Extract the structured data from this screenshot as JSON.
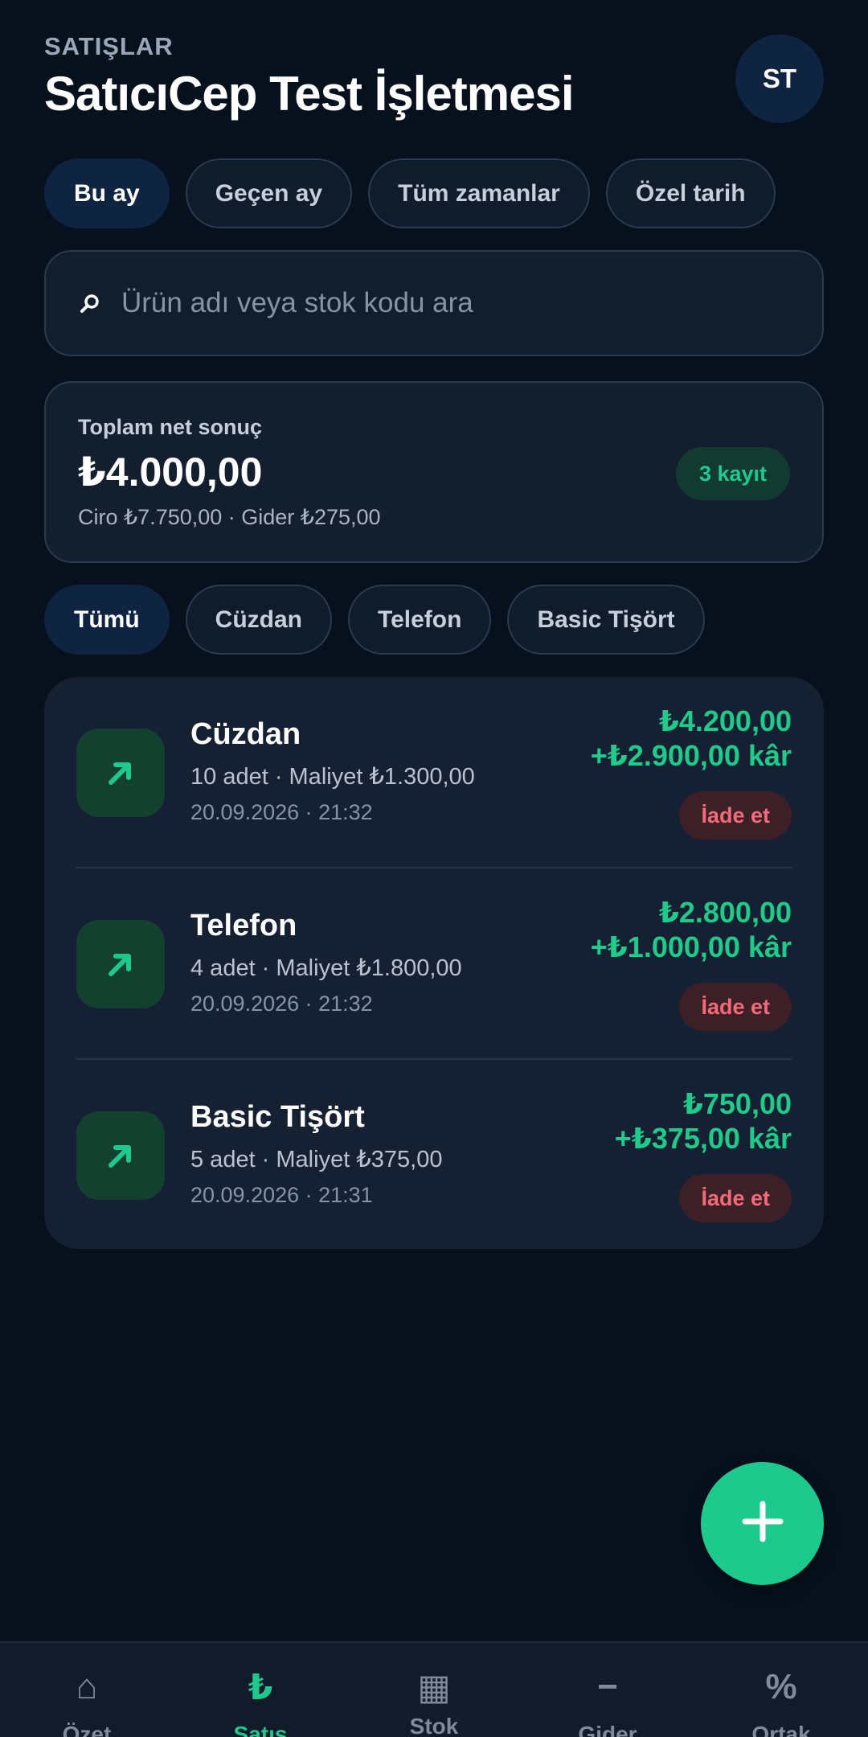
{
  "header": {
    "eyebrow": "SATIŞLAR",
    "title": "SatıcıCep Test İşletmesi",
    "avatar_initials": "ST"
  },
  "date_filters": [
    {
      "label": "Bu ay",
      "active": true
    },
    {
      "label": "Geçen ay",
      "active": false
    },
    {
      "label": "Tüm zamanlar",
      "active": false
    },
    {
      "label": "Özel tarih",
      "active": false
    }
  ],
  "search": {
    "placeholder": "Ürün adı veya stok kodu ara",
    "value": ""
  },
  "summary": {
    "label": "Toplam net sonuç",
    "value": "₺4.000,00",
    "subtitle": "Ciro ₺7.750,00 · Gider ₺275,00",
    "record_badge": "3 kayıt"
  },
  "category_filters": [
    {
      "label": "Tümü",
      "active": true
    },
    {
      "label": "Cüzdan",
      "active": false
    },
    {
      "label": "Telefon",
      "active": false
    },
    {
      "label": "Basic Tişört",
      "active": false
    }
  ],
  "sales": [
    {
      "name": "Cüzdan",
      "meta": "10 adet · Maliyet ₺1.300,00",
      "date": "20.09.2026 · 21:32",
      "amount": "₺4.200,00",
      "profit": "+₺2.900,00 kâr",
      "action": "İade et",
      "icon": "arrow-up-right-icon"
    },
    {
      "name": "Telefon",
      "meta": "4 adet · Maliyet ₺1.800,00",
      "date": "20.09.2026 · 21:32",
      "amount": "₺2.800,00",
      "profit": "+₺1.000,00 kâr",
      "action": "İade et",
      "icon": "arrow-up-right-icon"
    },
    {
      "name": "Basic Tişört",
      "meta": "5 adet · Maliyet ₺375,00",
      "date": "20.09.2026 · 21:31",
      "amount": "₺750,00",
      "profit": "+₺375,00 kâr",
      "action": "İade et",
      "icon": "arrow-up-right-icon"
    }
  ],
  "fab": {
    "icon": "plus-icon"
  },
  "tabbar": [
    {
      "label": "Özet",
      "icon": "home-icon",
      "glyph": "⌂",
      "active": false
    },
    {
      "label": "Satış",
      "icon": "lira-icon",
      "glyph": "₺",
      "active": true
    },
    {
      "label": "Stok",
      "icon": "grid-icon",
      "glyph": "▦",
      "active": false
    },
    {
      "label": "Gider",
      "icon": "minus-icon",
      "glyph": "−",
      "active": false
    },
    {
      "label": "Ortak",
      "icon": "percent-icon",
      "glyph": "%",
      "active": false
    }
  ],
  "colors": {
    "background": "#07111e",
    "accent": "#1ec98e",
    "danger": "#f36b77",
    "card": "#152032"
  }
}
